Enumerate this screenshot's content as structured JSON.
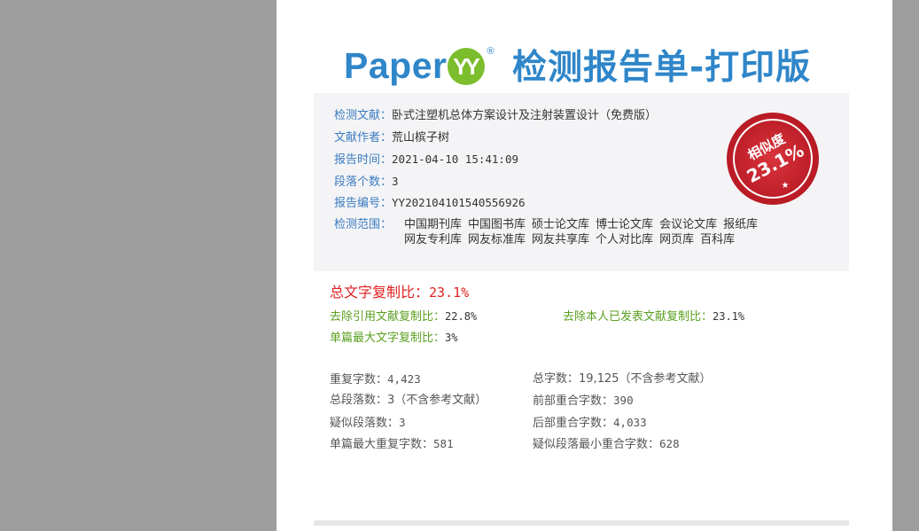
{
  "header": {
    "logo_text": "Paper",
    "logo_badge": "YY",
    "logo_reg": "®",
    "title": "检测报告单-打印版"
  },
  "info": {
    "title_label": "检测文献：",
    "title_value": "卧式注塑机总体方案设计及注射装置设计（免费版）",
    "author_label": "文献作者：",
    "author_value": "荒山槟子树",
    "time_label": "报告时间：",
    "time_value": "2021-04-10 15:41:09",
    "paragraphs_label": "段落个数：",
    "paragraphs_value": "3",
    "id_label": "报告编号：",
    "id_value": "YY202104101540556926",
    "scope_label": "检测范围：",
    "scope_line1": [
      "中国期刊库",
      "中国图书库",
      "硕士论文库",
      "博士论文库",
      "会议论文库",
      "报纸库"
    ],
    "scope_line2": [
      "网友专利库",
      "网友标准库",
      "网友共享库",
      "个人对比库",
      "网页库",
      "百科库"
    ]
  },
  "stamp": {
    "label": "相似度",
    "value": "23.1%",
    "color": "#c8202a"
  },
  "results": {
    "total_label": "总文字复制比：",
    "total_value": "23.1%",
    "excl_cite_label": "去除引用文献复制比：",
    "excl_cite_value": "22.8%",
    "excl_self_label": "去除本人已发表文献复制比：",
    "excl_self_value": "23.1%",
    "single_max_label": "单篇最大文字复制比：",
    "single_max_value": "3%"
  },
  "stats": {
    "repeat_chars_label": "重复字数：",
    "repeat_chars_value": "4,423",
    "total_chars_label": "总字数：",
    "total_chars_value": "19,125（不含参考文献）",
    "total_paras_label": "总段落数：",
    "total_paras_value": "3（不含参考文献）",
    "front_overlap_label": "前部重合字数：",
    "front_overlap_value": "390",
    "suspect_paras_label": "疑似段落数：",
    "suspect_paras_value": "3",
    "back_overlap_label": "后部重合字数：",
    "back_overlap_value": "4,033",
    "single_max_repeat_label": "单篇最大重复字数：",
    "single_max_repeat_value": "581",
    "suspect_min_overlap_label": "疑似段落最小重合字数：",
    "suspect_min_overlap_value": "628"
  }
}
